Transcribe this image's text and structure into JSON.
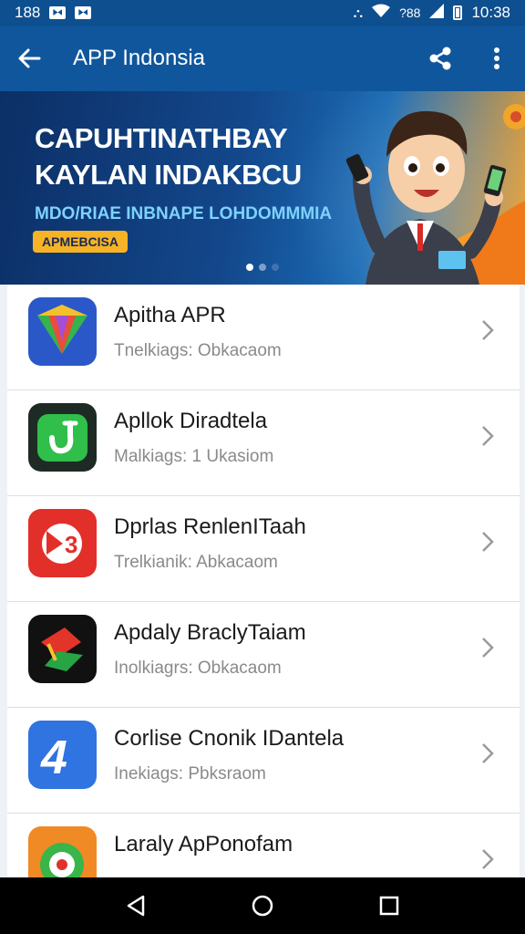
{
  "status_bar": {
    "left_text": "188",
    "time": "10:38",
    "signal_text": "?88"
  },
  "app_bar": {
    "title": "APP Indonsia",
    "icons": [
      "back-arrow-icon",
      "share-icon",
      "more-vert-icon"
    ]
  },
  "banner": {
    "headline_line1": "CAPUHTINATHBAY",
    "headline_line2": "KAYLAN INDAKBCU",
    "subtitle": "MDO/RIAE INBNAPE LOHDOMMMIA",
    "tag": "APMEBCISA",
    "page_dots": 3,
    "active_dot": 0
  },
  "apps": [
    {
      "name": "Apitha APR",
      "subtitle": "Tnelkiags: Obkacaom",
      "icon": "diamond-app-icon"
    },
    {
      "name": "Apllok Diradtela",
      "subtitle": "Malkiags: 1 Ukasiom",
      "icon": "green-check-app-icon"
    },
    {
      "name": "Dprlas RenlenITaah",
      "subtitle": "Trelkianik: Abkacaom",
      "icon": "red-badge-app-icon"
    },
    {
      "name": "Apdaly BraclyTaiam",
      "subtitle": "Inolkiagrs: Obkacaom",
      "icon": "red-green-app-icon"
    },
    {
      "name": "Corlise Cnonik IDantela",
      "subtitle": "Inekiags: Pbksraom",
      "icon": "blue-four-app-icon"
    },
    {
      "name": "Laraly ApPonofam",
      "subtitle": "",
      "icon": "orange-green-app-icon"
    }
  ],
  "colors": {
    "app_bar": "#10569c",
    "status_bar": "#0e4f8f",
    "banner_tag": "#f6b325"
  }
}
